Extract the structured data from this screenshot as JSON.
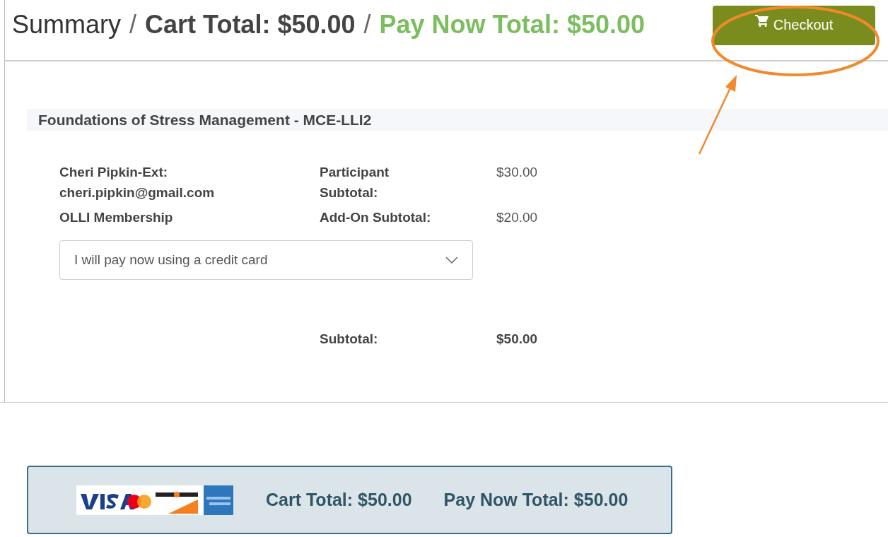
{
  "header": {
    "title": "Summary",
    "separator": "/",
    "cart_total": "Cart Total: $50.00",
    "pay_now_total": "Pay Now Total: $50.00",
    "checkout_button": "Checkout"
  },
  "course": {
    "title": "Foundations of Stress Management - MCE-LLI2",
    "lines": [
      {
        "name": "Cheri Pipkin-Ext:",
        "detail": "cheri.pipkin@gmail.com",
        "label": "Participant",
        "label_2": "Subtotal:",
        "amount": "$30.00"
      },
      {
        "name": "OLLI Membership",
        "label": "Add-On Subtotal:",
        "amount": "$20.00"
      }
    ],
    "payment_select": {
      "value": "I will pay now using a credit card"
    },
    "subtotal": {
      "label": "Subtotal:",
      "amount": "$50.00"
    }
  },
  "footer": {
    "cart_total": "Cart Total: $50.00",
    "pay_now_total": "Pay Now Total: $50.00"
  }
}
